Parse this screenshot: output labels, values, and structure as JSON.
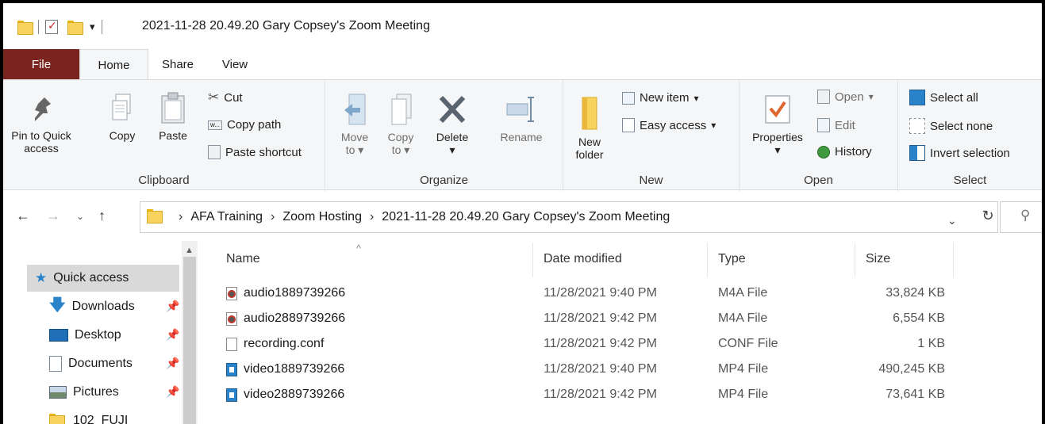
{
  "window": {
    "title": "2021-11-28 20.49.20 Gary Copsey's Zoom Meeting"
  },
  "quick_access_toolbar": {
    "dropdown_glyph": "▾"
  },
  "ribbon_tabs": [
    {
      "label": "File"
    },
    {
      "label": "Home"
    },
    {
      "label": "Share"
    },
    {
      "label": "View"
    }
  ],
  "ribbon": {
    "clipboard": {
      "pin_label_1": "Pin to Quick",
      "pin_label_2": "access",
      "copy": "Copy",
      "paste": "Paste",
      "cut": "Cut",
      "copy_path": "Copy path",
      "paste_shortcut": "Paste shortcut",
      "group": "Clipboard"
    },
    "organize": {
      "move_1": "Move",
      "move_2": "to",
      "copy_1": "Copy",
      "copy_2": "to",
      "delete": "Delete",
      "rename": "Rename",
      "group": "Organize"
    },
    "new": {
      "new_folder_1": "New",
      "new_folder_2": "folder",
      "new_item": "New item",
      "easy_access": "Easy access",
      "group": "New"
    },
    "open": {
      "properties": "Properties",
      "open": "Open",
      "edit": "Edit",
      "history": "History",
      "group": "Open"
    },
    "select": {
      "select_all": "Select all",
      "select_none": "Select none",
      "invert_selection": "Invert selection",
      "group": "Select"
    }
  },
  "address": {
    "crumbs": [
      "AFA Training",
      "Zoom Hosting",
      "2021-11-28 20.49.20 Gary Copsey's Zoom Meeting"
    ],
    "separator": "›"
  },
  "nav_pane": {
    "items": [
      {
        "label": "Quick access",
        "icon": "star-icon",
        "pinned": false
      },
      {
        "label": "Downloads",
        "icon": "download-arrow-icon",
        "pinned": true
      },
      {
        "label": "Desktop",
        "icon": "desktop-icon",
        "pinned": true
      },
      {
        "label": "Documents",
        "icon": "documents-icon",
        "pinned": true
      },
      {
        "label": "Pictures",
        "icon": "pictures-icon",
        "pinned": true
      },
      {
        "label": "102_FUJI",
        "icon": "folder-icon",
        "pinned": false
      }
    ]
  },
  "file_list": {
    "columns": {
      "name": "Name",
      "date": "Date modified",
      "type": "Type",
      "size": "Size"
    },
    "rows": [
      {
        "name": "audio1889739266",
        "date": "11/28/2021 9:40 PM",
        "type": "M4A File",
        "size": "33,824 KB",
        "icon": "audio-file-icon"
      },
      {
        "name": "audio2889739266",
        "date": "11/28/2021 9:42 PM",
        "type": "M4A File",
        "size": "6,554 KB",
        "icon": "audio-file-icon"
      },
      {
        "name": "recording.conf",
        "date": "11/28/2021 9:42 PM",
        "type": "CONF File",
        "size": "1 KB",
        "icon": "blank-file-icon"
      },
      {
        "name": "video1889739266",
        "date": "11/28/2021 9:40 PM",
        "type": "MP4 File",
        "size": "490,245 KB",
        "icon": "video-file-icon"
      },
      {
        "name": "video2889739266",
        "date": "11/28/2021 9:42 PM",
        "type": "MP4 File",
        "size": "73,641 KB",
        "icon": "video-file-icon"
      }
    ]
  },
  "colors": {
    "file_tab": "#7a2420",
    "folder": "#f8d35e",
    "selection": "#d9d9d9",
    "accent_blue": "#2a83c8"
  }
}
